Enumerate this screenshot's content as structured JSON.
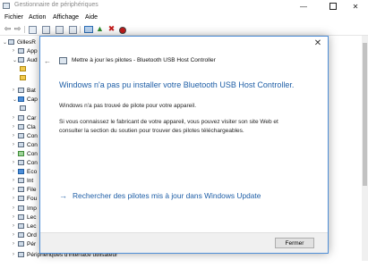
{
  "window": {
    "title": "Gestionnaire de périphériques",
    "min_glyph": "—",
    "close_glyph": "✕"
  },
  "menu": [
    "Fichier",
    "Action",
    "Affichage",
    "Aide"
  ],
  "toolbar": {
    "icons": [
      "back-icon",
      "forward-icon",
      "properties-icon",
      "list-icon",
      "help-icon",
      "monitor-icon",
      "add-driver-icon",
      "uninstall-icon",
      "disable-icon"
    ]
  },
  "tree": {
    "root": "GillesR",
    "items": [
      "App",
      "Aud",
      "",
      "",
      "Bat",
      "Cap",
      "",
      "Car",
      "Cla",
      "Con",
      "Con",
      "Con",
      "Con",
      "Eco",
      "Int",
      "File",
      "Fou",
      "Imp",
      "Lec",
      "Lec",
      "Ord",
      "Pér",
      "Périphériques d'interface utilisateur"
    ]
  },
  "dialog": {
    "close_glyph": "✕",
    "back_glyph": "←",
    "header": "Mettre à jour les pilotes - Bluetooth USB Host Controller",
    "main_message": "Windows n'a pas pu installer votre Bluetooth USB Host Controller.",
    "not_found": "Windows n'a pas trouvé de pilote pour votre appareil.",
    "manufacturer_info": "Si vous connaissez le fabricant de votre appareil, vous pouvez visiter son site Web et consulter la section du soutien pour trouver des pilotes téléchargeables.",
    "link_arrow": "→",
    "windows_update_link": "Rechercher des pilotes mis à jour dans Windows Update",
    "close_button": "Fermer"
  }
}
